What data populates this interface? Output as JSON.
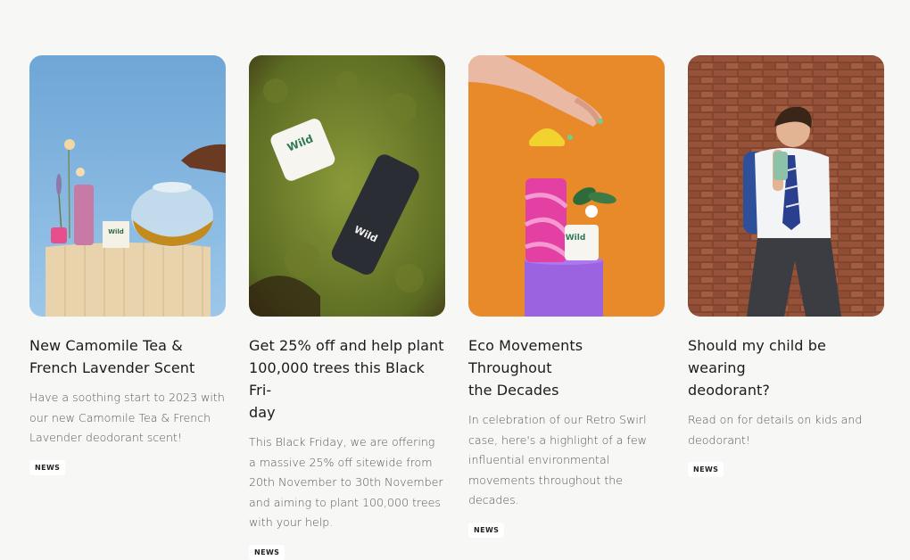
{
  "cards": [
    {
      "title_lines": [
        "New Camomile Tea &",
        "French Lavender Scent"
      ],
      "description": "Have a soothing start to 2023 with our new Camomile Tea & French Lavender deodorant scent!",
      "badge": "NEWS",
      "image_icon": "tea-deodorant-photo",
      "brand": "Wild"
    },
    {
      "title_lines": [
        "Get 25% off and help plant",
        "100,000 trees this Black Fri-",
        "day"
      ],
      "description": "This Black Friday, we are offering a massive 25% off sitewide from 20th November to 30th November and aiming to plant 100,000 trees with your help.",
      "badge": "NEWS",
      "image_icon": "moss-deodorant-photo",
      "brand": "Wild"
    },
    {
      "title_lines": [
        "Eco Movements Throughout",
        "the Decades"
      ],
      "description": "In celebration of our Retro Swirl case, here's a highlight of a few influential environmental movements throughout the decades.",
      "badge": "NEWS",
      "image_icon": "swirl-case-photo",
      "brand": "Wild"
    },
    {
      "title_lines": [
        "Should my child be wearing",
        "deodorant?"
      ],
      "description": "Read on for details on kids and deodorant!",
      "badge": "NEWS",
      "image_icon": "child-brick-wall-photo"
    }
  ],
  "colors": {
    "background": "#f7f7f6",
    "title": "#1b1b1b",
    "description": "#555555",
    "badge_bg": "#ffffff"
  }
}
